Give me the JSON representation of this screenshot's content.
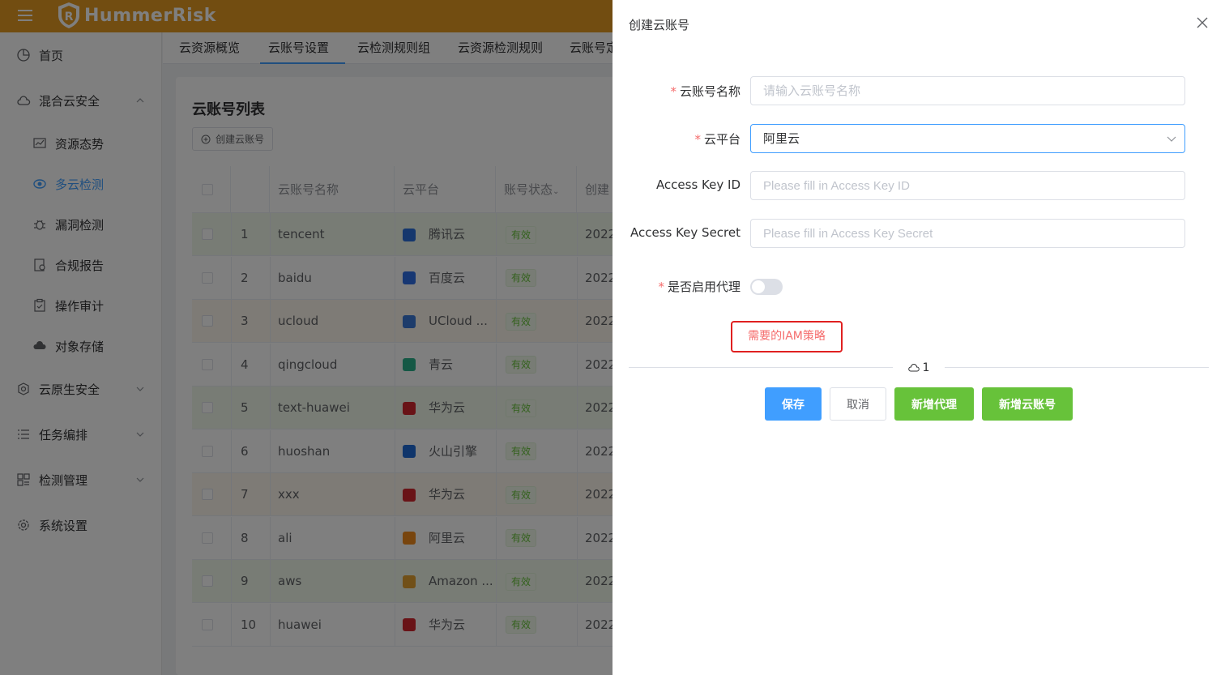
{
  "header": {
    "brand": "HummerRisk",
    "brand_color": "#e59b22"
  },
  "sidebar": {
    "items": [
      {
        "label": "首页",
        "icon": "pie-chart-icon"
      },
      {
        "label": "混合云安全",
        "icon": "cloud-icon",
        "expanded": true
      },
      {
        "label": "云原生安全",
        "icon": "cloud-native-icon"
      },
      {
        "label": "任务编排",
        "icon": "list-icon"
      },
      {
        "label": "检测管理",
        "icon": "grid-icon"
      },
      {
        "label": "系统设置",
        "icon": "gear-icon"
      }
    ],
    "sub_items": [
      {
        "label": "资源态势",
        "icon": "trend-icon"
      },
      {
        "label": "多云检测",
        "icon": "scan-icon",
        "active": true
      },
      {
        "label": "漏洞检测",
        "icon": "bug-icon"
      },
      {
        "label": "合规报告",
        "icon": "report-icon"
      },
      {
        "label": "操作审计",
        "icon": "audit-icon"
      },
      {
        "label": "对象存储",
        "icon": "storage-icon"
      }
    ]
  },
  "tabs": [
    {
      "label": "云资源概览"
    },
    {
      "label": "云账号设置",
      "active": true
    },
    {
      "label": "云检测规则组"
    },
    {
      "label": "云资源检测规则"
    },
    {
      "label": "云账号定"
    }
  ],
  "main": {
    "title": "云账号列表",
    "create_button": "创建云账号",
    "columns": [
      "云账号名称",
      "云平台",
      "账号状态",
      "创建"
    ],
    "rows": [
      {
        "index": "1",
        "name": "tencent",
        "platform": "腾讯云",
        "status": "有效",
        "created": "2022-",
        "icon": "tencent-cloud-icon"
      },
      {
        "index": "2",
        "name": "baidu",
        "platform": "百度云",
        "status": "有效",
        "created": "2022-",
        "icon": "baidu-cloud-icon"
      },
      {
        "index": "3",
        "name": "ucloud",
        "platform": "UCloud ...",
        "status": "有效",
        "created": "2022-",
        "icon": "ucloud-icon"
      },
      {
        "index": "4",
        "name": "qingcloud",
        "platform": "青云",
        "status": "有效",
        "created": "2022-",
        "icon": "qingcloud-icon"
      },
      {
        "index": "5",
        "name": "text-huawei",
        "platform": "华为云",
        "status": "有效",
        "created": "2022-",
        "icon": "huawei-cloud-icon"
      },
      {
        "index": "6",
        "name": "huoshan",
        "platform": "火山引擎",
        "status": "有效",
        "created": "2022-",
        "icon": "volcengine-icon"
      },
      {
        "index": "7",
        "name": "xxx",
        "platform": "华为云",
        "status": "有效",
        "created": "2022-",
        "icon": "huawei-cloud-icon"
      },
      {
        "index": "8",
        "name": "ali",
        "platform": "阿里云",
        "status": "有效",
        "created": "2022-",
        "icon": "aliyun-icon"
      },
      {
        "index": "9",
        "name": "aws",
        "platform": "Amazon ...",
        "status": "有效",
        "created": "2022-",
        "icon": "aws-icon"
      },
      {
        "index": "10",
        "name": "huawei",
        "platform": "华为云",
        "status": "有效",
        "created": "2022-",
        "icon": "huawei-cloud-icon"
      }
    ]
  },
  "drawer": {
    "title": "创建云账号",
    "fields": {
      "name_label": "云账号名称",
      "name_placeholder": "请输入云账号名称",
      "platform_label": "云平台",
      "platform_value": "阿里云",
      "ak_label": "Access Key ID",
      "ak_placeholder": "Please fill in Access Key ID",
      "sk_label": "Access Key Secret",
      "sk_placeholder": "Please fill in Access Key Secret",
      "proxy_label": "是否启用代理"
    },
    "required_mark": "*",
    "iam_link": "需要的IAM策略",
    "divider_text": "1",
    "buttons": {
      "save": "保存",
      "cancel": "取消",
      "add_proxy": "新增代理",
      "add_account": "新增云账号"
    }
  }
}
